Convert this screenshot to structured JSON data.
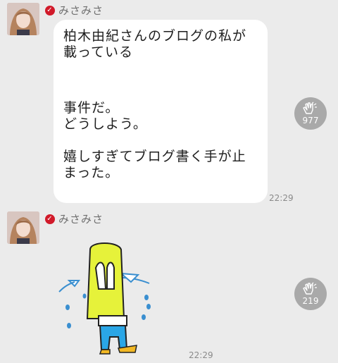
{
  "messages": [
    {
      "sender": "みさみさ",
      "text": {
        "line1": "柏木由紀さんのブログの私が\n載っている",
        "line2": "事件だ。\nどうしよう。",
        "line3": "嬉しすぎてブログ書く手が止\nまった。"
      },
      "time": "22:29",
      "claps": "977"
    },
    {
      "sender": "みさみさ",
      "sticker": "crying-girl-sticker",
      "time": "22:29",
      "claps": "219"
    }
  ],
  "icons": {
    "verified": "check-badge-icon",
    "clap": "clapping-hands-icon"
  },
  "colors": {
    "background": "#ebebeb",
    "verified": "#d11a2a",
    "clap_badge": "#a9a9a9",
    "sticker_hair": "#e6f23a",
    "sticker_pants": "#2aa6e6"
  }
}
